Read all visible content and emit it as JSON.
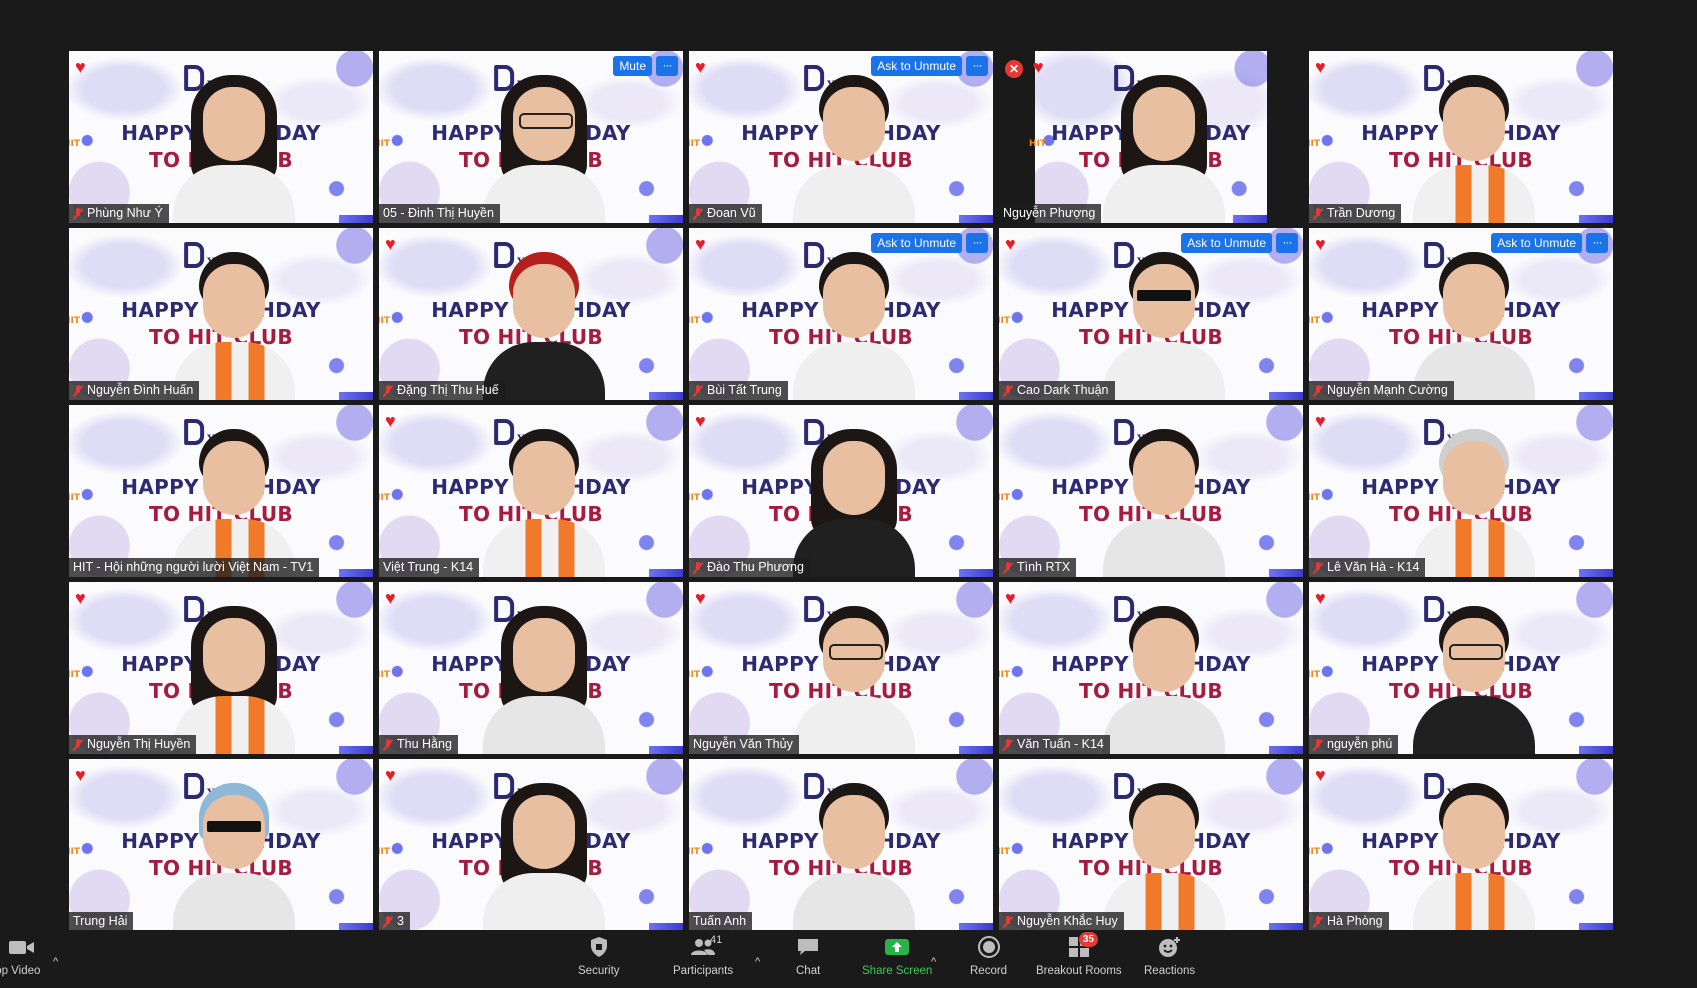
{
  "gallery": {
    "tiles": [
      {
        "name": "Phùng Như Ý",
        "heart": true,
        "muted": true
      },
      {
        "name": "05 - Đinh Thị Huyền",
        "heart": false,
        "muted": false,
        "action": "Mute"
      },
      {
        "name": "Đoan Vũ",
        "heart": true,
        "muted": true,
        "action": "Ask to Unmute"
      },
      {
        "name": "Nguyễn Phượng",
        "heart": true,
        "muted": false
      },
      {
        "name": "Trần Dương",
        "heart": true,
        "muted": true
      },
      {
        "name": "Nguyễn Đình Huấn",
        "heart": false,
        "muted": true
      },
      {
        "name": "Đặng Thị Thu Huế",
        "heart": true,
        "muted": true
      },
      {
        "name": "Bùi Tất Trung",
        "heart": true,
        "muted": true,
        "action": "Ask to Unmute"
      },
      {
        "name": "Cao Dark Thuận",
        "heart": true,
        "muted": true,
        "action": "Ask to Unmute"
      },
      {
        "name": "Nguyễn Mạnh Cường",
        "heart": true,
        "muted": true,
        "action": "Ask to Unmute"
      },
      {
        "name": "HIT - Hội những người lười Việt Nam - TV1",
        "heart": false,
        "muted": false
      },
      {
        "name": "Việt Trung - K14",
        "heart": true,
        "muted": false
      },
      {
        "name": "Đào Thu Phương",
        "heart": true,
        "muted": true
      },
      {
        "name": "Tình RTX",
        "heart": false,
        "muted": true
      },
      {
        "name": "Lê Văn Hà - K14",
        "heart": true,
        "muted": true
      },
      {
        "name": "Nguyễn Thị Huyền",
        "heart": true,
        "muted": true
      },
      {
        "name": "Thu Hằng",
        "heart": true,
        "muted": true
      },
      {
        "name": "Nguyễn Văn Thủy",
        "heart": true,
        "muted": false
      },
      {
        "name": "Văn Tuấn - K14",
        "heart": true,
        "muted": true
      },
      {
        "name": "nguyễn phú",
        "heart": true,
        "muted": true
      },
      {
        "name": "Trung Hải",
        "heart": true,
        "muted": false
      },
      {
        "name": "3",
        "heart": true,
        "muted": true
      },
      {
        "name": "Tuấn Anh",
        "heart": false,
        "muted": false
      },
      {
        "name": "Nguyễn Khắc Huy",
        "heart": false,
        "muted": true
      },
      {
        "name": "Hà Phòng",
        "heart": true,
        "muted": true
      }
    ],
    "background": {
      "line1": "HAPPY BIRTHDAY",
      "line2": "TO HIT CLUB",
      "logo": "YEARS",
      "hex": "HIT"
    },
    "more_glyph": "···",
    "leave_badge_glyph": "✕",
    "heart_glyph": "♥",
    "active_speaker_color": "#c8e34a",
    "button_color": "#1a73e8"
  },
  "toolbar": {
    "video_label": "top Video",
    "security_label": "Security",
    "participants_label": "Participants",
    "participants_count": "41",
    "chat_label": "Chat",
    "share_label": "Share Screen",
    "record_label": "Record",
    "breakout_label": "Breakout Rooms",
    "breakout_badge": "35",
    "reactions_label": "Reactions",
    "caret": "^",
    "share_color": "#3cc85a"
  }
}
